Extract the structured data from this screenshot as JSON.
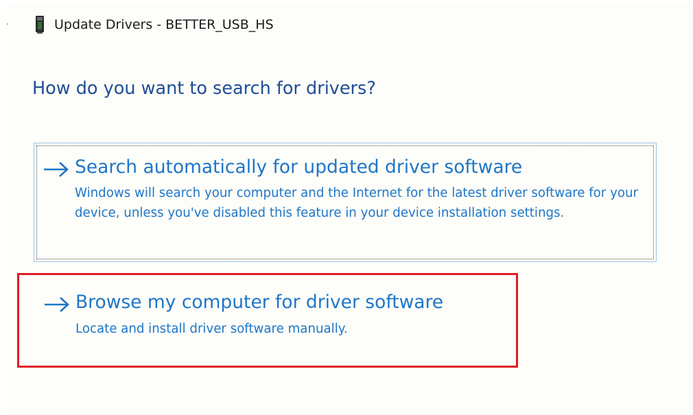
{
  "window": {
    "title": "Update Drivers - BETTER_USB_HS",
    "icon": "usb-device-icon"
  },
  "heading": "How do you want to search for drivers?",
  "options": [
    {
      "title": "Search automatically for updated driver software",
      "description": "Windows will search your computer and the Internet for the latest driver software for your device, unless you've disabled this feature in your device installation settings.",
      "icon": "arrow-right-icon",
      "focused": true,
      "highlighted": false
    },
    {
      "title": "Browse my computer for driver software",
      "description": "Locate and install driver software manually.",
      "icon": "arrow-right-icon",
      "focused": false,
      "highlighted": true
    }
  ],
  "colors": {
    "heading": "#1f4e96",
    "link": "#1e76c8",
    "highlight_border": "#e01b24",
    "focus_border": "#9ec5e6"
  }
}
